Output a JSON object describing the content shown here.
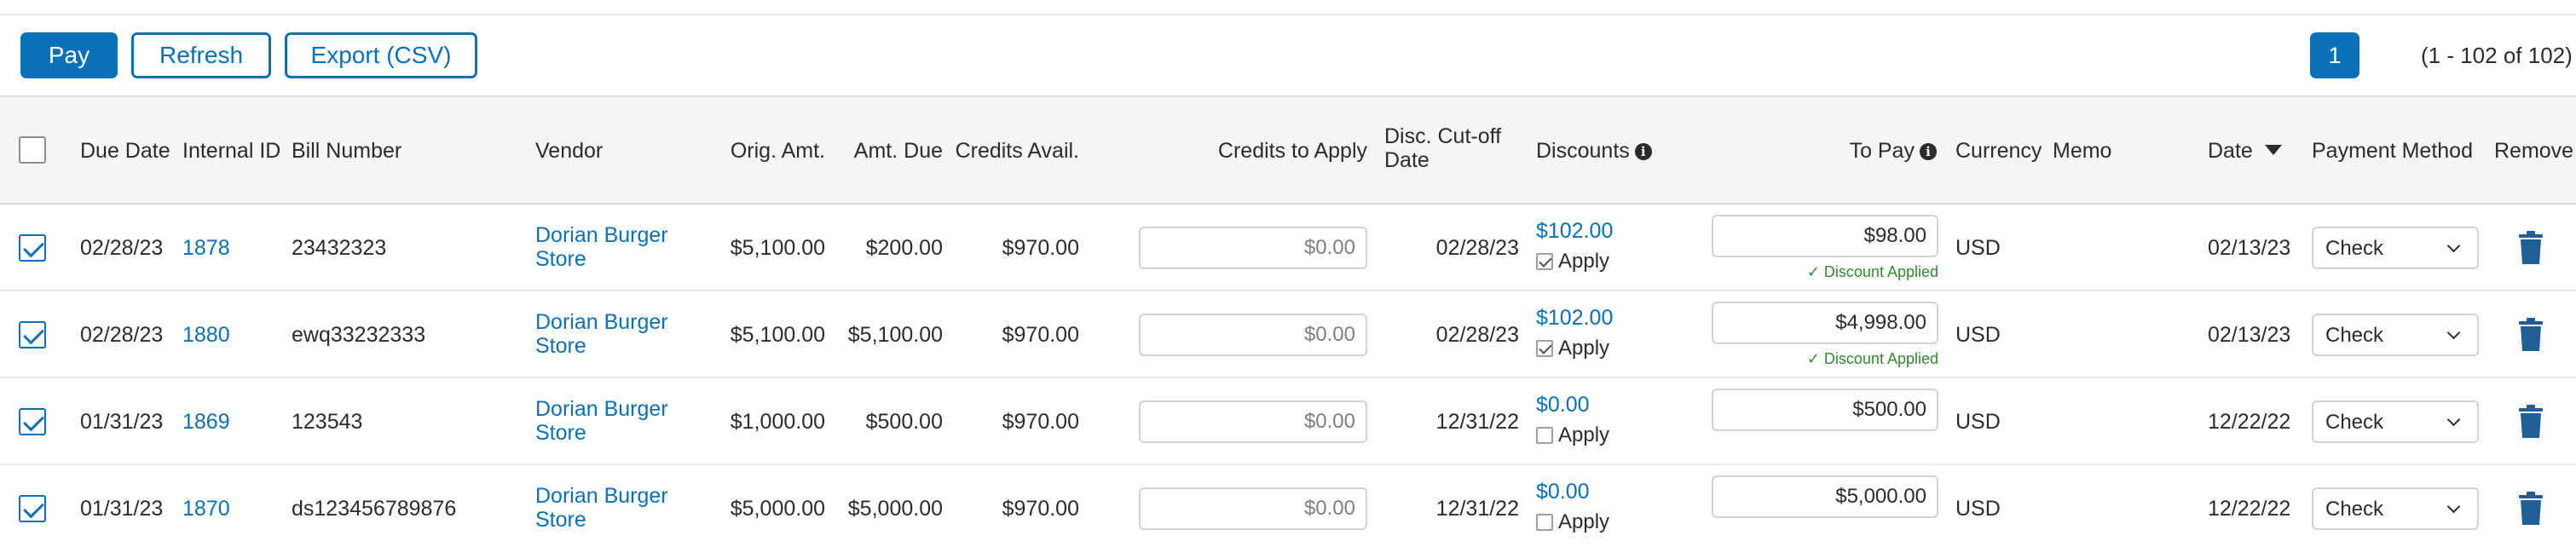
{
  "toolbar": {
    "pay_label": "Pay",
    "refresh_label": "Refresh",
    "export_label": "Export (CSV)"
  },
  "pagination": {
    "page": "1",
    "range": "(1 - 102 of 102)"
  },
  "columns": {
    "due_date": "Due Date",
    "internal_id": "Internal ID",
    "bill_number": "Bill Number",
    "vendor": "Vendor",
    "orig_amt": "Orig. Amt.",
    "amt_due": "Amt. Due",
    "credits_avail": "Credits Avail.",
    "credits_to_apply": "Credits to Apply",
    "disc_cutoff": "Disc. Cut-off Date",
    "discounts": "Discounts",
    "to_pay": "To Pay",
    "currency": "Currency",
    "memo": "Memo",
    "date": "Date",
    "payment_method": "Payment Method",
    "remove": "Remove"
  },
  "apply_label": "Apply",
  "discount_applied_label": "✓ Discount Applied",
  "colors": {
    "accent": "#0a70b7",
    "success": "#2e8b2e"
  },
  "rows": [
    {
      "selected": true,
      "due_date": "02/28/23",
      "internal_id": "1878",
      "bill_number": "23432323",
      "vendor": "Dorian Burger Store",
      "orig_amt": "$5,100.00",
      "amt_due": "$200.00",
      "credits_avail": "$970.00",
      "credits_to_apply": "$0.00",
      "disc_cutoff": "02/28/23",
      "discount": "$102.00",
      "apply_checked": true,
      "to_pay": "$98.00",
      "discount_applied": true,
      "currency": "USD",
      "memo": "",
      "date": "02/13/23",
      "payment_method": "Check"
    },
    {
      "selected": true,
      "due_date": "02/28/23",
      "internal_id": "1880",
      "bill_number": "ewq33232333",
      "vendor": "Dorian Burger Store",
      "orig_amt": "$5,100.00",
      "amt_due": "$5,100.00",
      "credits_avail": "$970.00",
      "credits_to_apply": "$0.00",
      "disc_cutoff": "02/28/23",
      "discount": "$102.00",
      "apply_checked": true,
      "to_pay": "$4,998.00",
      "discount_applied": true,
      "currency": "USD",
      "memo": "",
      "date": "02/13/23",
      "payment_method": "Check"
    },
    {
      "selected": true,
      "due_date": "01/31/23",
      "internal_id": "1869",
      "bill_number": "123543",
      "vendor": "Dorian Burger Store",
      "orig_amt": "$1,000.00",
      "amt_due": "$500.00",
      "credits_avail": "$970.00",
      "credits_to_apply": "$0.00",
      "disc_cutoff": "12/31/22",
      "discount": "$0.00",
      "apply_checked": false,
      "to_pay": "$500.00",
      "discount_applied": false,
      "currency": "USD",
      "memo": "",
      "date": "12/22/22",
      "payment_method": "Check"
    },
    {
      "selected": true,
      "due_date": "01/31/23",
      "internal_id": "1870",
      "bill_number": "ds123456789876",
      "vendor": "Dorian Burger Store",
      "orig_amt": "$5,000.00",
      "amt_due": "$5,000.00",
      "credits_avail": "$970.00",
      "credits_to_apply": "$0.00",
      "disc_cutoff": "12/31/22",
      "discount": "$0.00",
      "apply_checked": false,
      "to_pay": "$5,000.00",
      "discount_applied": false,
      "currency": "USD",
      "memo": "",
      "date": "12/22/22",
      "payment_method": "Check"
    }
  ]
}
